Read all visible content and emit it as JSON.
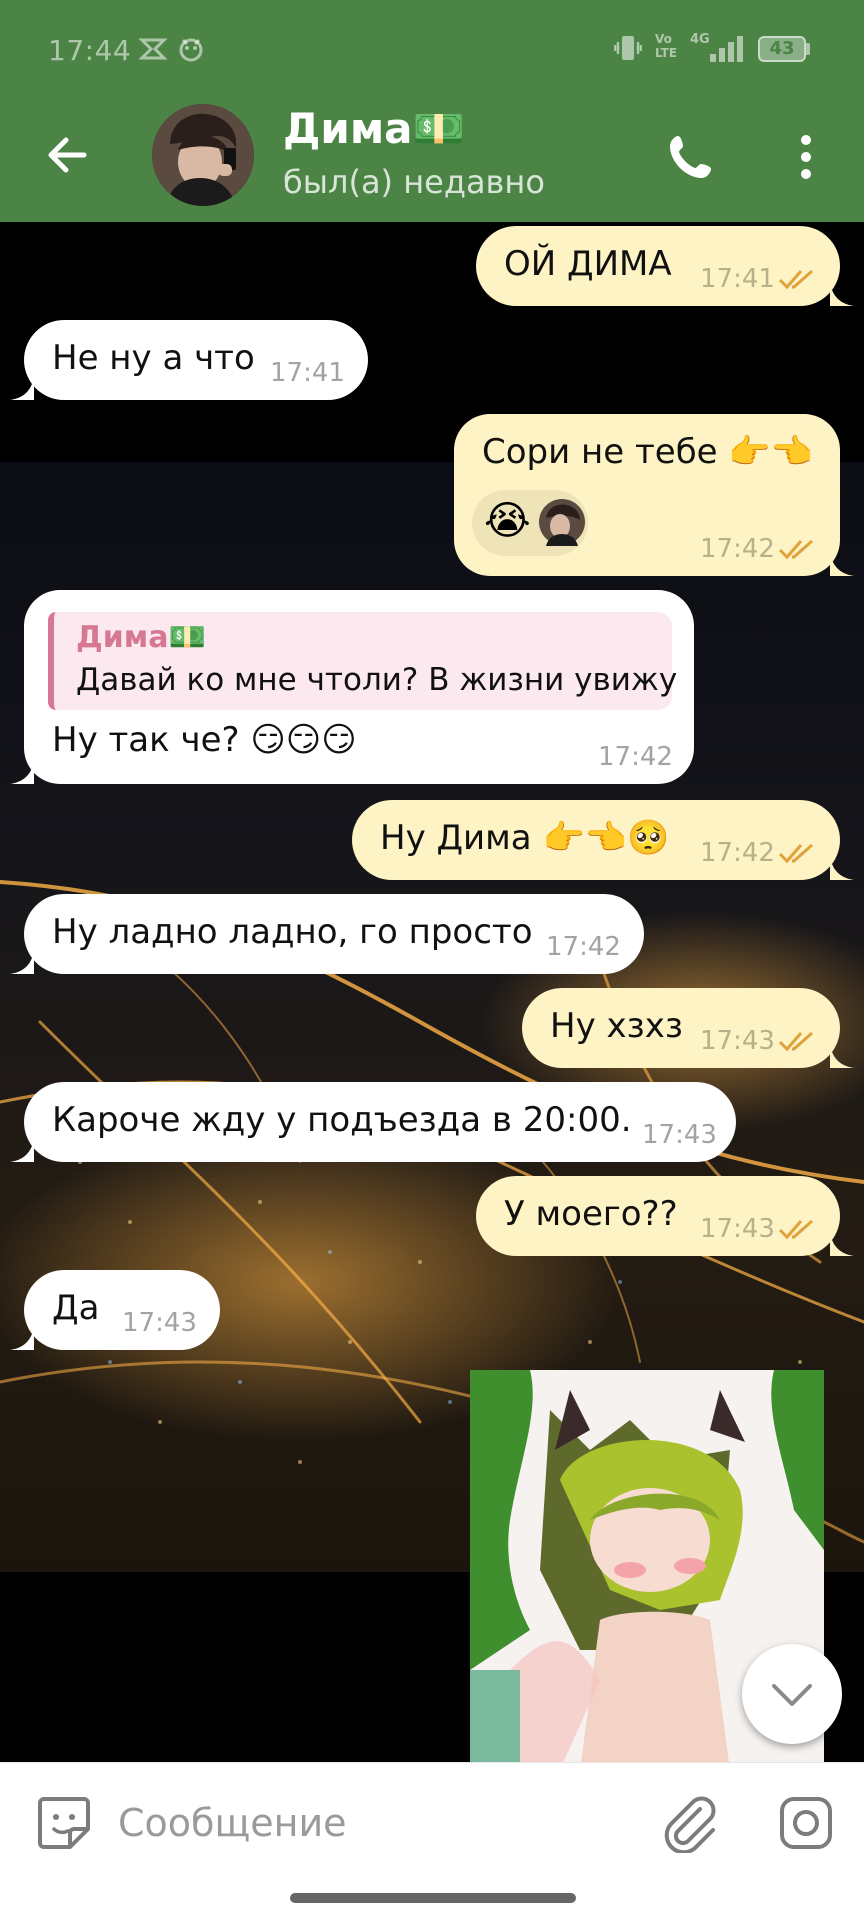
{
  "colors": {
    "header": "#4c8446",
    "incoming": "#ffffff",
    "outgoing": "#fdf3c4",
    "reply_accent": "#d67893"
  },
  "status_bar": {
    "time": "17:44",
    "battery": "43",
    "network": "4G",
    "volte": "Vo LTE"
  },
  "header": {
    "contact_name": "Дима💵",
    "contact_status": "был(а) недавно",
    "icons": [
      "back-arrow-icon",
      "avatar",
      "phone-icon",
      "more-vert-icon"
    ]
  },
  "messages": [
    {
      "dir": "out",
      "text": "ОЙ ДИМА",
      "time": "17:41"
    },
    {
      "dir": "in",
      "text": "Не ну а что",
      "time": "17:41"
    },
    {
      "dir": "out",
      "text": "Сори не тебе 👉👈",
      "emoji": "😭",
      "time": "17:42"
    },
    {
      "dir": "in",
      "reply_name": "Дима💵",
      "reply_text": "Давай ко мне чтоли? В жизни увижу",
      "text": "Ну так че? 😏😏😏",
      "time": "17:42"
    },
    {
      "dir": "out",
      "text": "Ну Дима 👉👈🥺",
      "time": "17:42"
    },
    {
      "dir": "in",
      "text": "Ну ладно ладно, го просто",
      "time": "17:42"
    },
    {
      "dir": "out",
      "text": "Ну хзхз",
      "time": "17:43"
    },
    {
      "dir": "in",
      "text": "Кароче жду у подъезда в 20:00.",
      "time": "17:43"
    },
    {
      "dir": "out",
      "text": "У моего??",
      "time": "17:43"
    },
    {
      "dir": "in",
      "text": "Да",
      "time": "17:43"
    }
  ],
  "input": {
    "placeholder": "Сообщение"
  }
}
